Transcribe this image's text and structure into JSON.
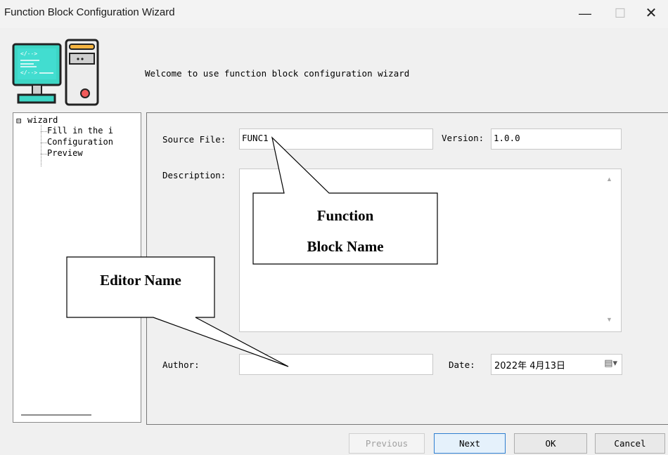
{
  "window": {
    "title": "Function Block Configuration Wizard",
    "minimize": "—",
    "maximize": "☐",
    "close": "✕"
  },
  "header": {
    "welcome_text": "Welcome to use function block configuration wizard",
    "logo_icon": "computer-code-icon"
  },
  "tree": {
    "root": "wizard",
    "expander": "⊟",
    "items": [
      "Fill in the i",
      "Configuration",
      "Preview"
    ]
  },
  "form": {
    "source_file_label": "Source File:",
    "source_file_value": "FUNC1",
    "version_label": "Version:",
    "version_value": "1.0.0",
    "description_label": "Description:",
    "description_value": "",
    "author_label": "Author:",
    "author_value": "",
    "date_label": "Date:",
    "date_value": "2022年 4月13日"
  },
  "buttons": {
    "previous": "Previous",
    "next": "Next",
    "ok": "OK",
    "cancel": "Cancel"
  },
  "callouts": {
    "function_block_line1": "Function",
    "function_block_line2": "Block Name",
    "editor": "Editor Name"
  },
  "colors": {
    "accent": "#2f7fd0",
    "window_bg": "#f0f0f0"
  }
}
